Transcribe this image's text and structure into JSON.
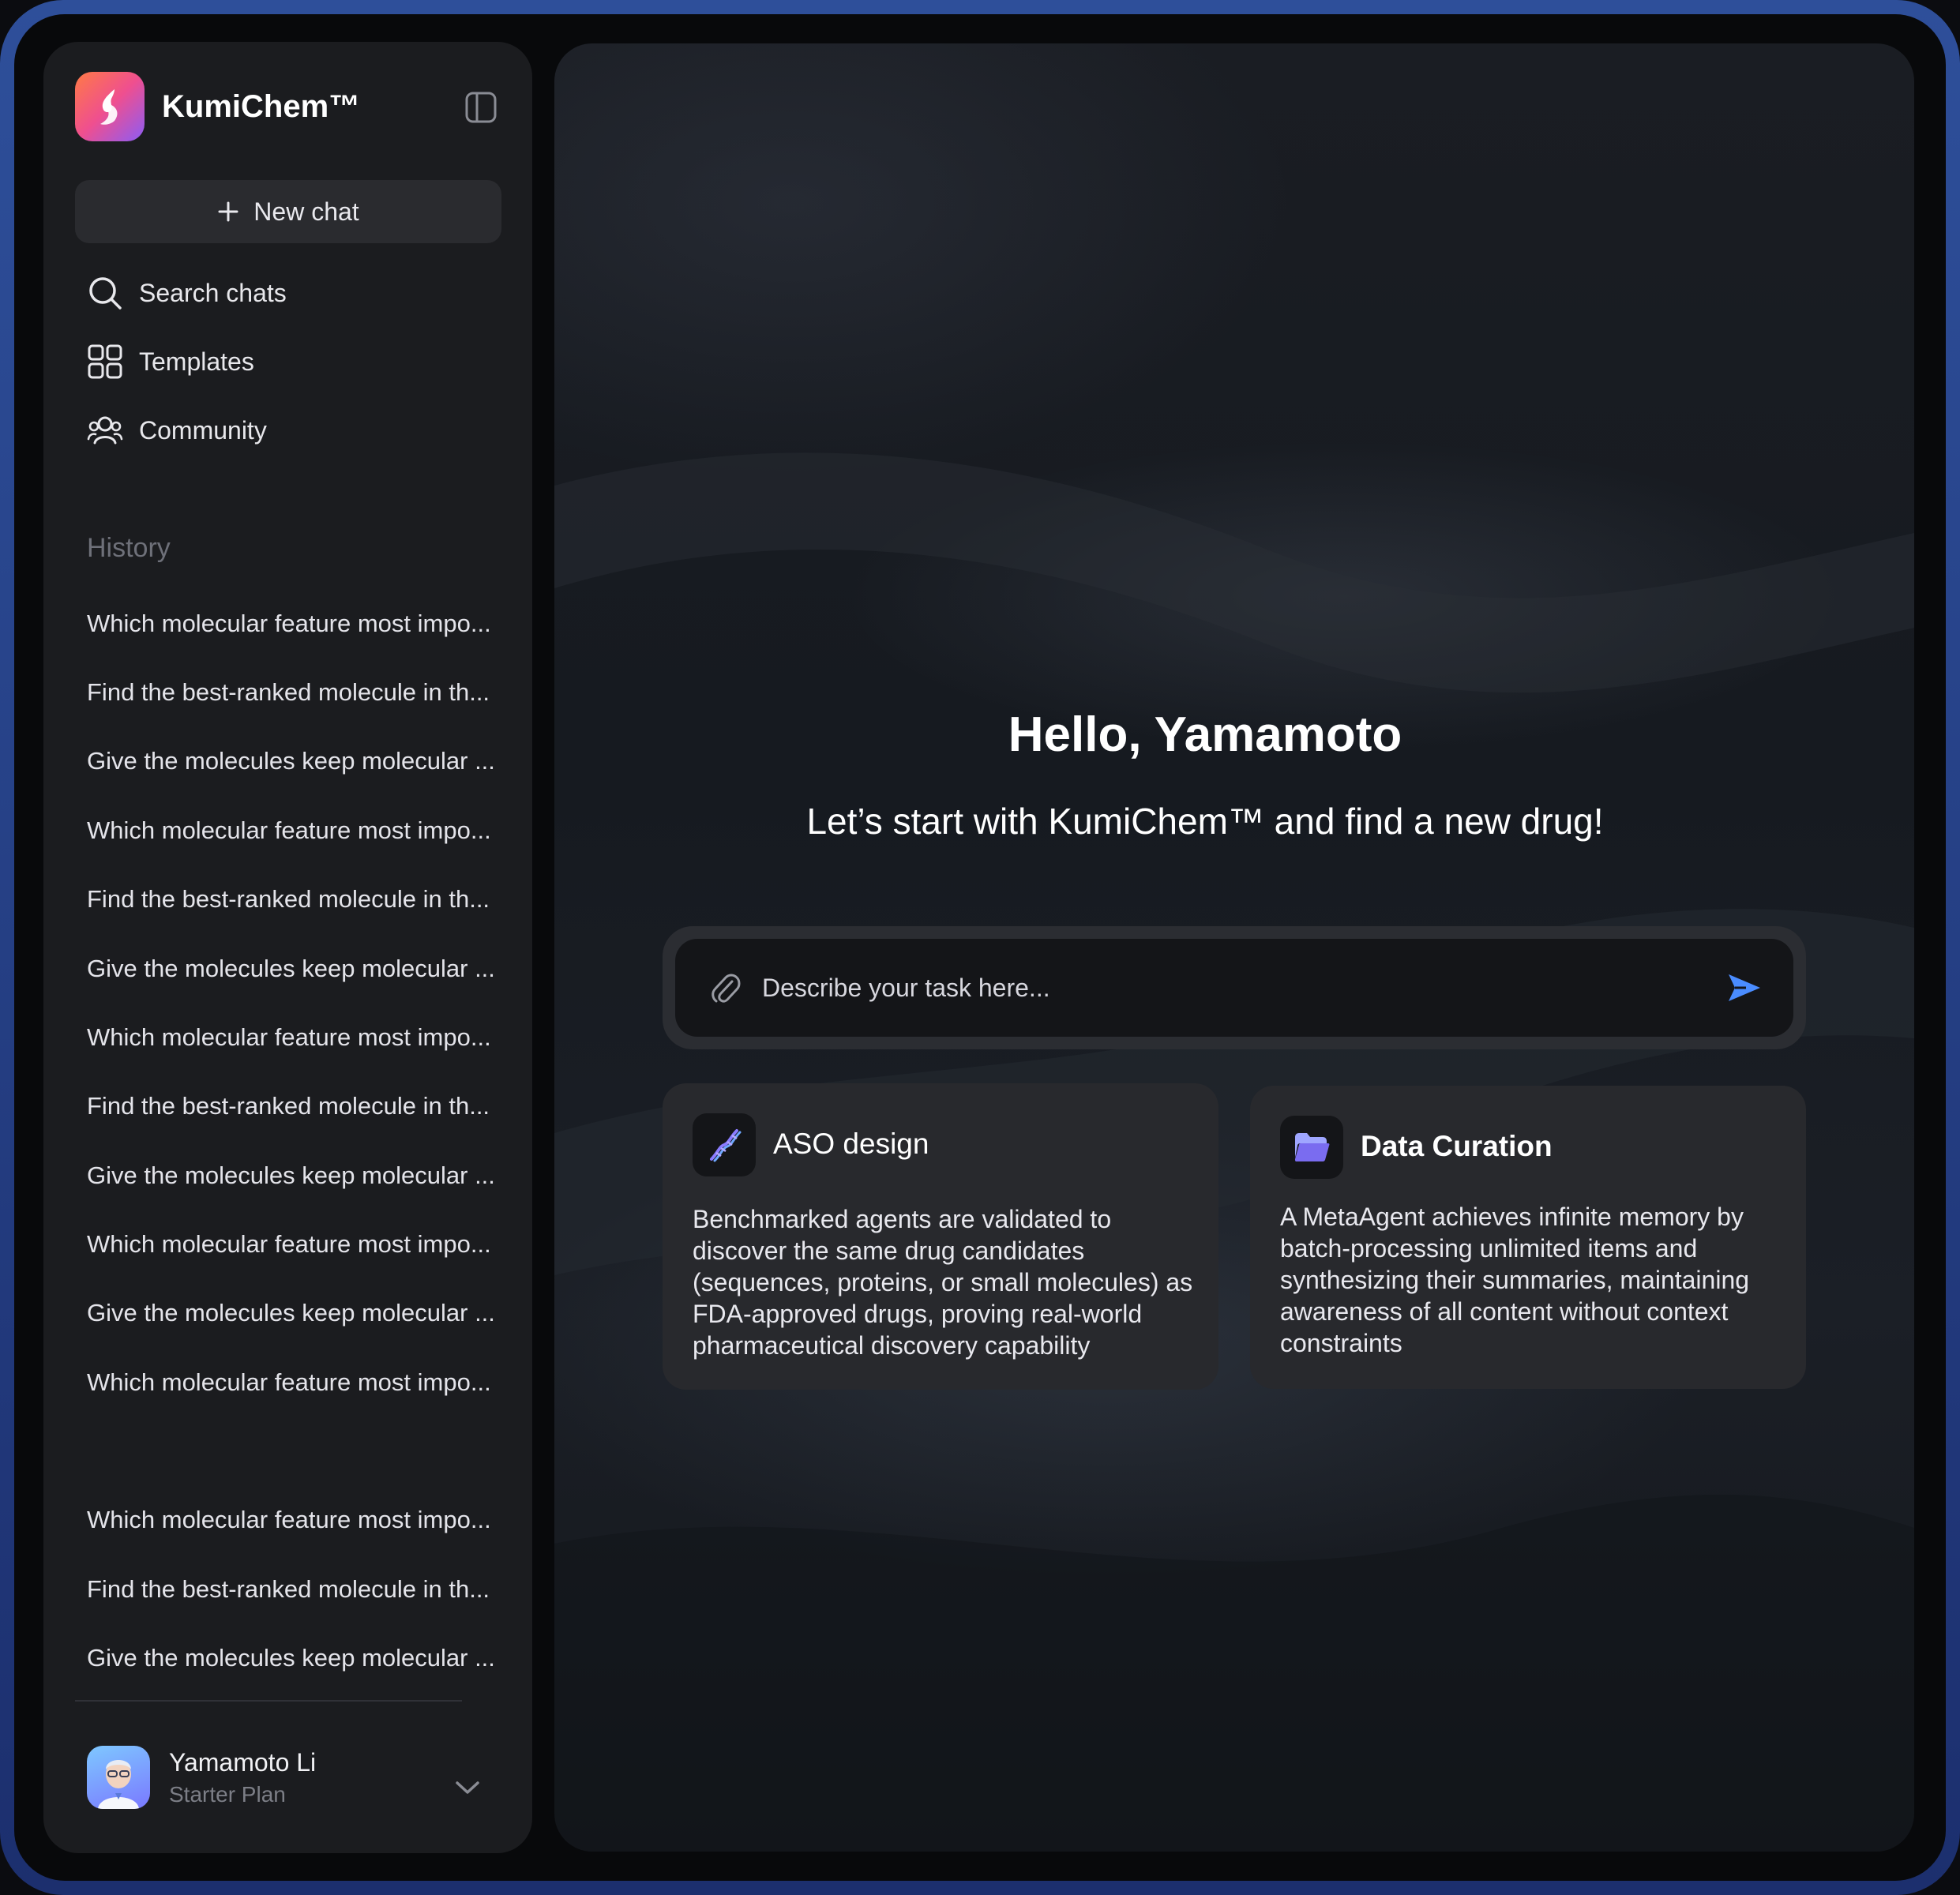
{
  "app": {
    "name": "KumiChem™"
  },
  "sidebar": {
    "new_chat_label": "New chat",
    "nav": [
      {
        "label": "Search chats",
        "icon": "search-icon"
      },
      {
        "label": "Templates",
        "icon": "grid-icon"
      },
      {
        "label": "Community",
        "icon": "people-icon"
      }
    ],
    "history_label": "History",
    "history": [
      "Which molecular feature most impo...",
      "Find the best-ranked molecule in th...",
      "Give the molecules keep molecular ...",
      "Which molecular feature most impo...",
      "Find the best-ranked molecule in th...",
      "Give the molecules keep molecular ...",
      "Which molecular feature most impo...",
      "Find the best-ranked molecule in th...",
      "Give the molecules keep molecular ...",
      "Which molecular feature most impo...",
      "Give the molecules keep molecular ...",
      "Which molecular feature most impo...",
      "Which molecular feature most impo...",
      "Find the best-ranked molecule in th...",
      "Give the molecules keep molecular ..."
    ],
    "user": {
      "name": "Yamamoto Li",
      "plan": "Starter Plan"
    }
  },
  "main": {
    "greeting": "Hello, Yamamoto",
    "subtitle": "Let’s start with KumiChem™ and find a new drug!",
    "input": {
      "placeholder": "Describe your task here..."
    },
    "cards": [
      {
        "title": "ASO design",
        "icon": "dna-icon",
        "description": "Benchmarked agents are validated to discover the same drug candidates (sequences, proteins, or small molecules) as FDA-approved drugs, proving real-world pharmaceutical discovery capability"
      },
      {
        "title": "Data Curation",
        "icon": "folder-icon",
        "description": "A MetaAgent achieves infinite memory by batch-processing unlimited items and synthesizing their summaries, maintaining awareness of all content without context constraints"
      }
    ]
  },
  "colors": {
    "accent_send": "#4a8cff",
    "logo_gradient": [
      "#ff7a45",
      "#ef4f8f",
      "#8b5cf6"
    ]
  }
}
